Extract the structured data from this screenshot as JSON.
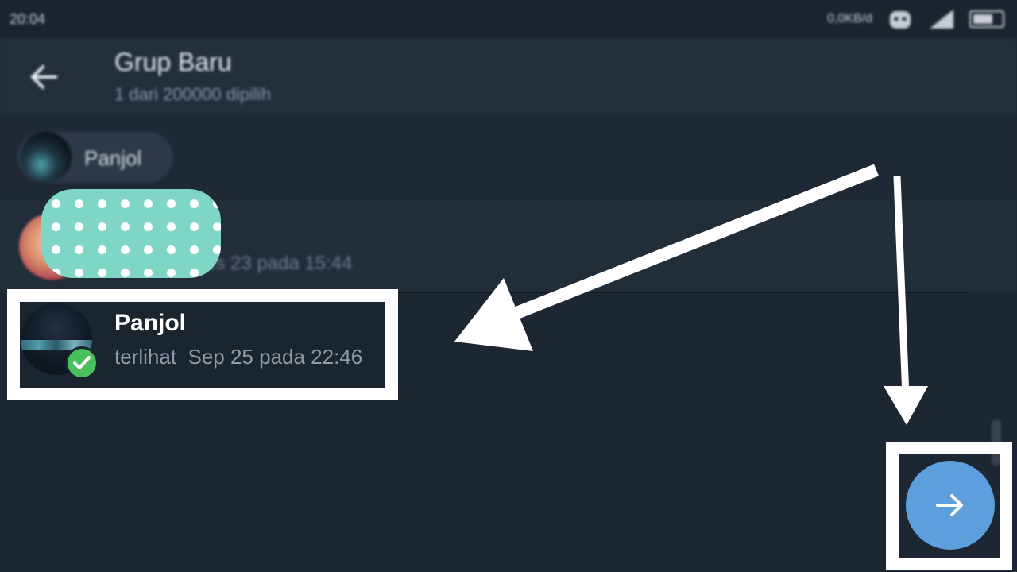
{
  "status_bar": {
    "time": "20:04",
    "speed": "0,0KB/d"
  },
  "header": {
    "title": "Grup Baru",
    "subtitle": "1 dari 200000 dipilih"
  },
  "selected_chip": {
    "label": "Panjol"
  },
  "blurred_contact": {
    "last_seen": "es 23 pada 15:44"
  },
  "highlighted_contact": {
    "name": "Panjol",
    "status": "terlihat  Sep 25 pada 22:46",
    "selected": true
  },
  "fab": {
    "icon": "arrow-right-icon",
    "color": "#5c9fdc"
  },
  "colors": {
    "background": "#1d2733",
    "header": "#232e3b",
    "check": "#48c15c",
    "annotation": "#ffffff"
  }
}
